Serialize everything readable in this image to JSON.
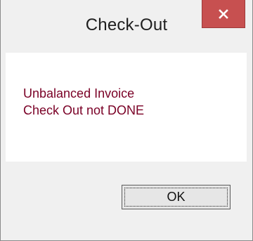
{
  "window": {
    "title": "Check-Out",
    "close_icon": "close-icon"
  },
  "message": {
    "line1": "Unbalanced Invoice",
    "line2": "Check Out not DONE",
    "color": "#7a0026"
  },
  "buttons": {
    "ok_label": "OK"
  },
  "colors": {
    "close_button": "#c75050",
    "window_bg": "#f0f0f0",
    "content_bg": "#ffffff"
  }
}
